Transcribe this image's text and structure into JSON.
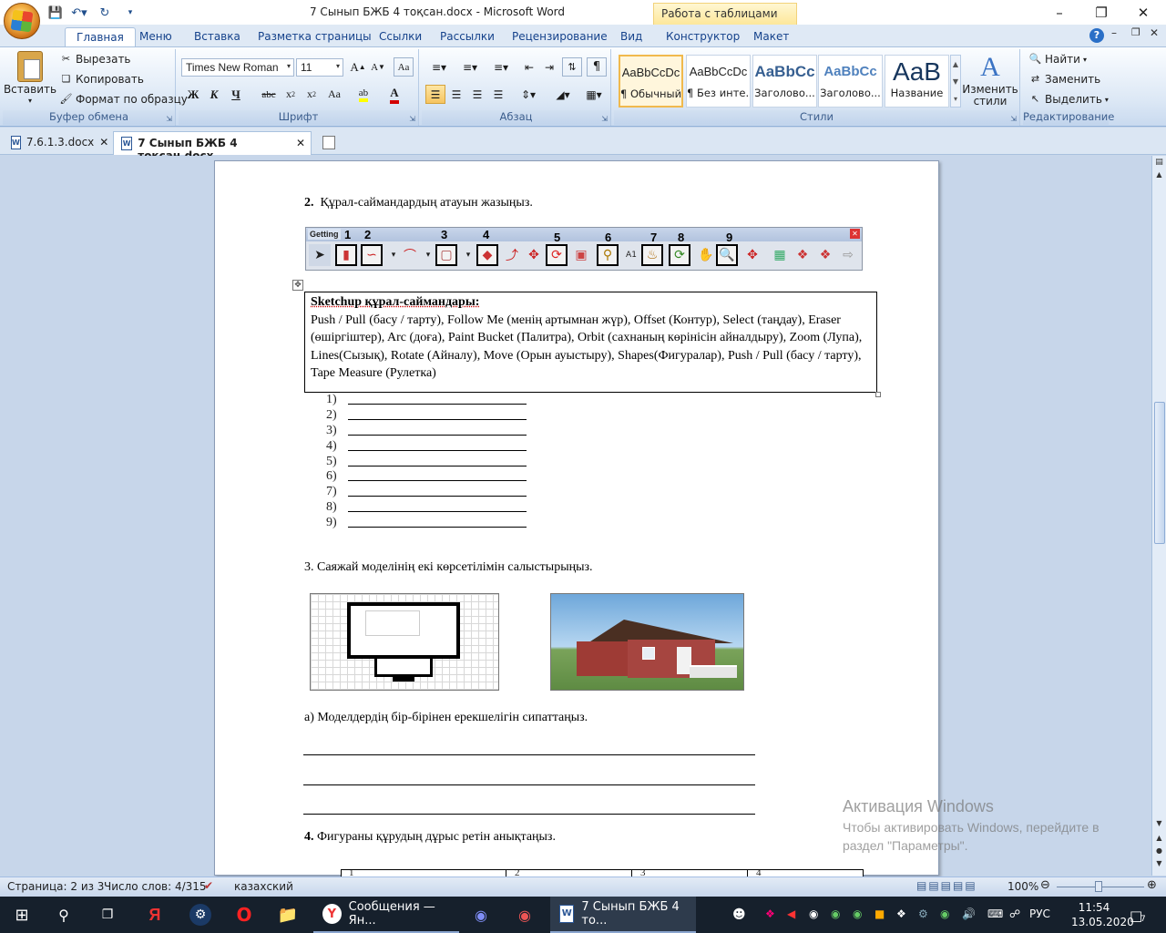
{
  "window": {
    "title": "7 Сынып БЖБ 4 тоқсан.docx - Microsoft Word",
    "context_tab": "Работа с таблицами"
  },
  "tabs": [
    "Главная",
    "Меню",
    "Вставка",
    "Разметка страницы",
    "Ссылки",
    "Рассылки",
    "Рецензирование",
    "Вид",
    "Конструктор",
    "Макет"
  ],
  "ribbon": {
    "clipboard": {
      "label": "Буфер обмена",
      "paste": "Вставить",
      "cut": "Вырезать",
      "copy": "Копировать",
      "format_painter": "Формат по образцу"
    },
    "font": {
      "label": "Шрифт",
      "font_name": "Times New Roman",
      "font_size": "11"
    },
    "paragraph": {
      "label": "Абзац"
    },
    "styles": {
      "label": "Стили",
      "change_styles": "Изменить стили",
      "items": [
        {
          "sample": "AaBbCcDc",
          "name": "¶ Обычный"
        },
        {
          "sample": "AaBbCcDc",
          "name": "¶ Без инте..."
        },
        {
          "sample": "AaBbCс",
          "name": "Заголово..."
        },
        {
          "sample": "AaBbCc",
          "name": "Заголово..."
        },
        {
          "sample": "AaB",
          "name": "Название"
        }
      ]
    },
    "editing": {
      "label": "Редактирование",
      "find": "Найти",
      "replace": "Заменить",
      "select": "Выделить"
    }
  },
  "doc_tabs": [
    "7.6.1.3.docx",
    "7 Сынып БЖБ 4 тоқсан.docx"
  ],
  "document": {
    "q2_num": "2.",
    "q2_text": "Құрал-саймандардың атауын жазыңыз.",
    "toolbar_title": "Getting",
    "tool_numbers": [
      "1",
      "2",
      "3",
      "4",
      "5",
      "6",
      "7",
      "8",
      "9"
    ],
    "box_title": "Sketchup құрал-саймандары:",
    "box_text": "Push / Pull (басу / тарту), Follow Me (менің артымнан жүр), Offset (Контур), Select (таңдау), Eraser (өшіргіштер), Arc (доға), Paint Bucket (Палитра), Orbit (сахнаның көрінісін айналдыру), Zoom (Лупа), Lines(Сызық), Rotate (Айналу), Move (Орын ауыстыру), Shapes(Фигуралар), Push / Pull (басу / тарту), Tape Measure (Рулетка)",
    "answers": [
      "1)",
      "2)",
      "3)",
      "4)",
      "5)",
      "6)",
      "7)",
      "8)",
      "9)"
    ],
    "q3": "3. Саяжай моделінің екі көрсетілімін салыстырыңыз.",
    "q3a": "а) Моделдердің бір-бірінен ерекшелігін сипаттаңыз.",
    "q4_num": "4.",
    "q4_text": "Фигураны құрудың дұрыс ретін анықтаңыз.",
    "table_headers": [
      "1",
      "2",
      "3",
      "4"
    ]
  },
  "activation": {
    "title": "Активация Windows",
    "text": "Чтобы активировать Windows, перейдите в раздел \"Параметры\"."
  },
  "status": {
    "page": "Страница: 2 из 3",
    "words": "Число слов: 4/315",
    "language": "казахский",
    "zoom": "100%"
  },
  "taskbar": {
    "yandex_app": "Сообщения — Ян...",
    "word_app": "7 Сынып БЖБ 4 то...",
    "lang": "РУС",
    "time": "11:54",
    "date": "13.05.2020",
    "notifications": "7"
  }
}
